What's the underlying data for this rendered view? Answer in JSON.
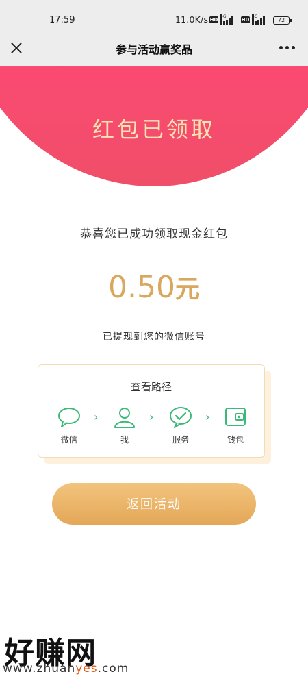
{
  "status_bar": {
    "time": "17:59",
    "network_speed": "11.0K/s",
    "hd_label": "HD",
    "signal_label": "5G",
    "battery": "72"
  },
  "nav": {
    "title": "参与活动赢奖品"
  },
  "header": {
    "title": "红包已领取",
    "color": "#fb4a73"
  },
  "main": {
    "congrats": "恭喜您已成功领取现金红包",
    "amount": "0.50",
    "amount_unit": "元",
    "withdrawn_note": "已提现到您的微信账号",
    "accent_color": "#d9a75e"
  },
  "path_card": {
    "title": "查看路径",
    "steps": [
      {
        "label": "微信",
        "icon": "chat-bubble-icon"
      },
      {
        "label": "我",
        "icon": "person-icon"
      },
      {
        "label": "服务",
        "icon": "check-circle-icon"
      },
      {
        "label": "钱包",
        "icon": "wallet-icon"
      }
    ],
    "icon_color": "#3cb878"
  },
  "button": {
    "label": "返回活动"
  },
  "watermark": {
    "text": "好赚网",
    "url_prefix": "www.zhuan",
    "url_highlight": "yes",
    "url_suffix": ".com"
  }
}
